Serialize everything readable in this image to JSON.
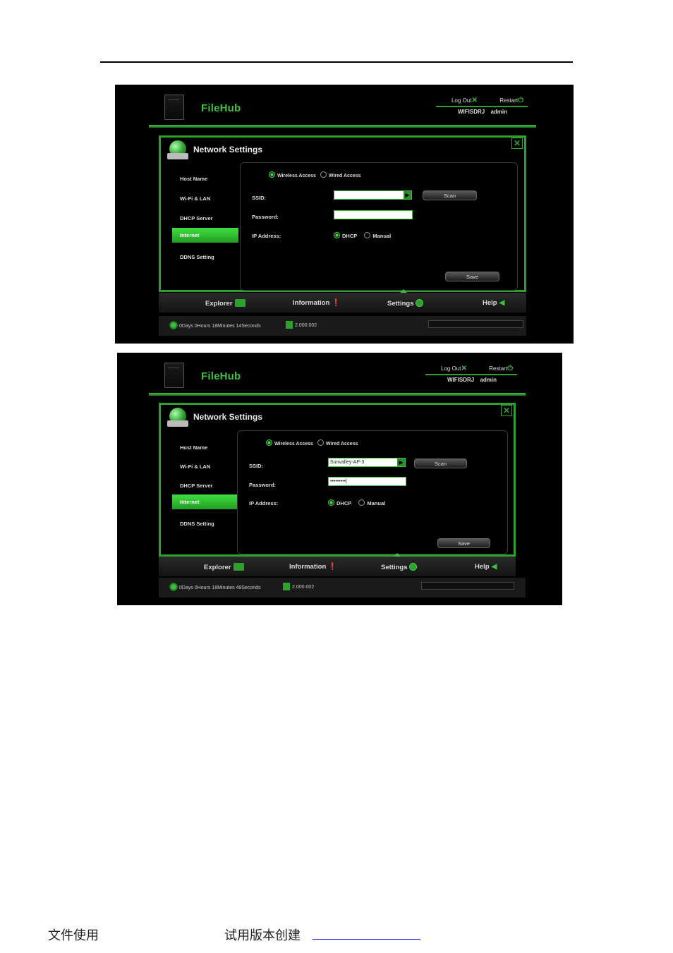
{
  "app": {
    "logo": "FileHub",
    "logout_label": "Log Out",
    "restart_label": "Restart",
    "user_line": "WIFISDRJ admin",
    "panel_title": "Network Settings"
  },
  "sidebar": {
    "items": [
      {
        "label": "Host Name"
      },
      {
        "label": "Wi-Fi & LAN"
      },
      {
        "label": "DHCP Server"
      },
      {
        "label": "Internet"
      },
      {
        "label": "DDNS Setting"
      }
    ]
  },
  "form": {
    "wireless_label": "Wireless Access",
    "wired_label": "Wired Access",
    "ssid_label": "SSID:",
    "password_label": "Password:",
    "ip_label": "IP Address:",
    "dhcp_label": "DHCP",
    "manual_label": "Manual",
    "scan_label": "Scan",
    "save_label": "Save"
  },
  "nav": {
    "explorer": "Explorer",
    "information": "Information",
    "settings": "Settings",
    "help": "Help"
  },
  "shot1": {
    "uptime": "0Days 0Hours 18Minutes 14Seconds",
    "version": "2.000.002",
    "ssid_value": "",
    "password_value": ""
  },
  "shot2": {
    "uptime": "0Days 0Hours 18Minutes 49Seconds",
    "version": "2.000.002",
    "ssid_value": "Sunvalley-AP-3",
    "password_value": "•••••••••|"
  },
  "footer": {
    "left": "文件使用",
    "middle": "试用版本创建"
  },
  "colors": {
    "accent": "#3fbf3f",
    "panel_border": "#2ea02e",
    "background": "#000000"
  }
}
